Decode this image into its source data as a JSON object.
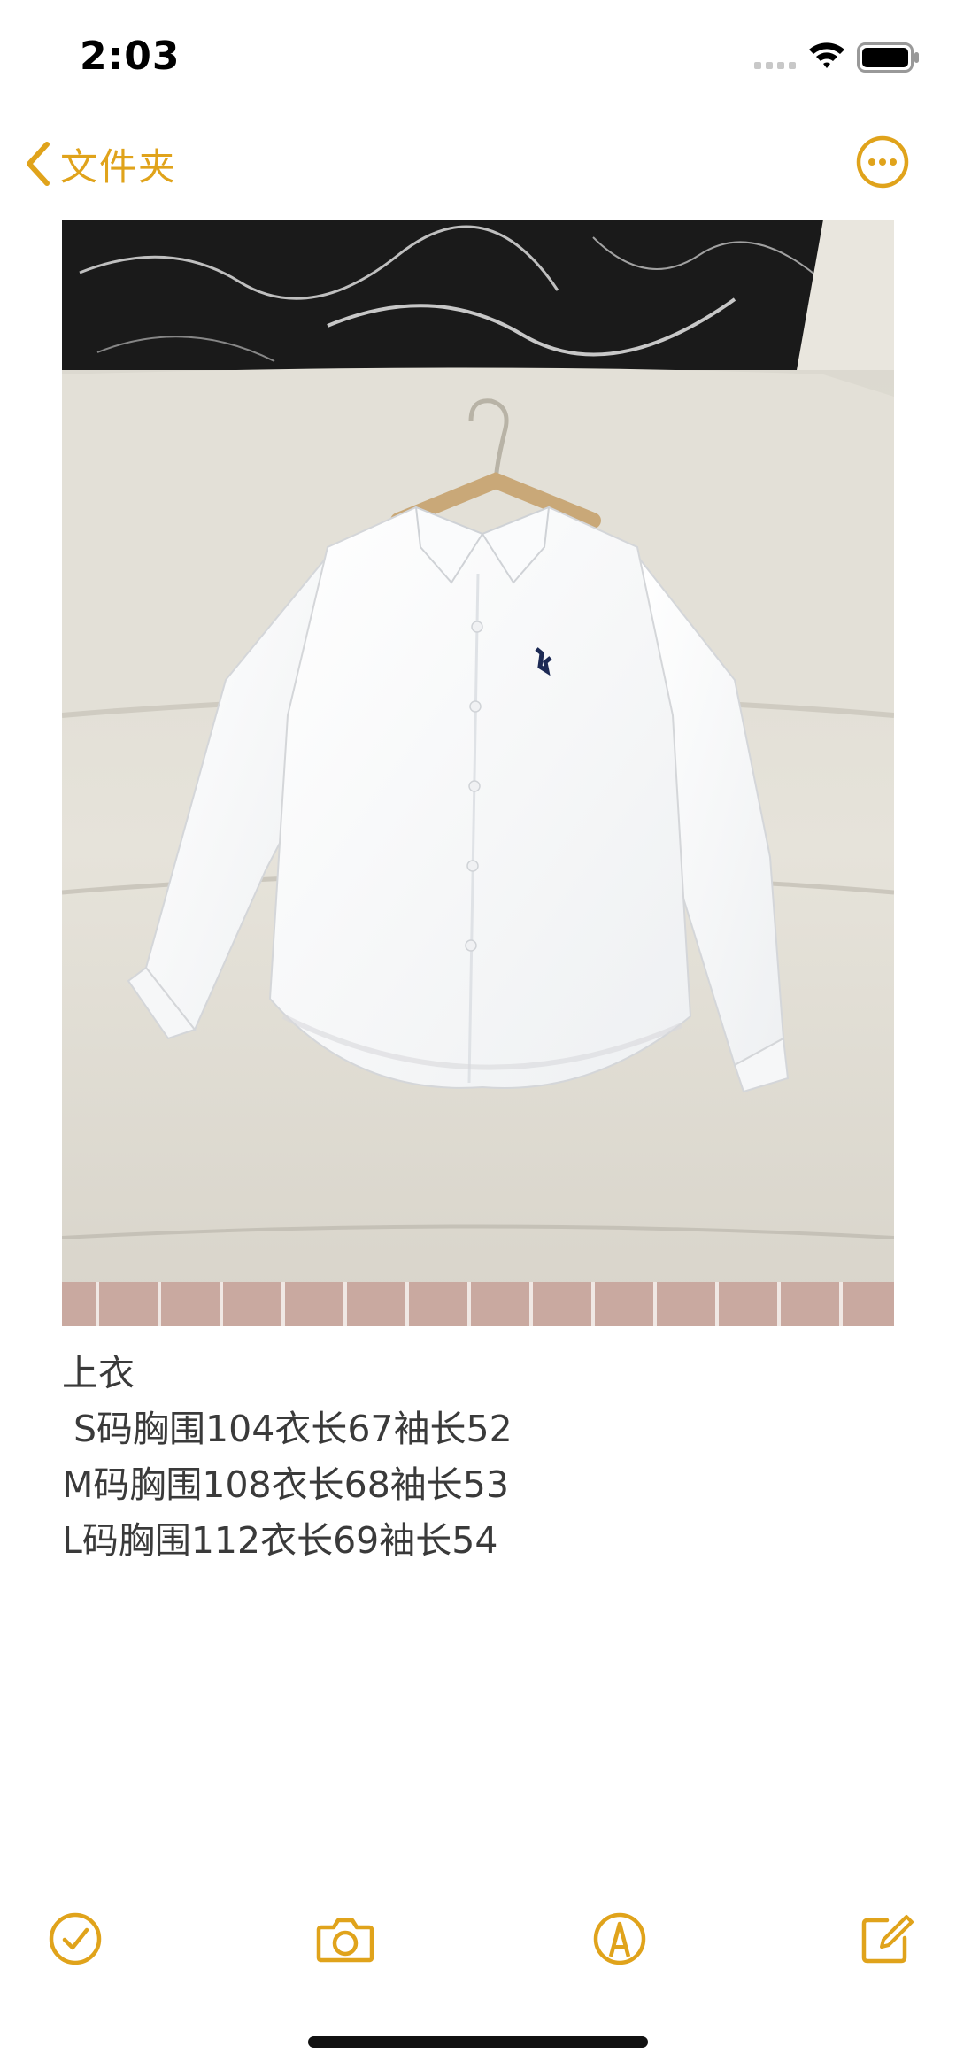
{
  "status_bar": {
    "time": "2:03"
  },
  "nav": {
    "back_label": "文件夹"
  },
  "note": {
    "lines": [
      "上衣",
      " S码胸围104衣长67袖长52",
      "M码胸围108衣长68袖长53",
      "L码胸围112衣长69袖长54"
    ]
  },
  "icons": {
    "back": "chevron-left-icon",
    "more": "ellipsis-circle-icon",
    "checklist": "checkmark-circle-icon",
    "camera": "camera-icon",
    "markup": "pen-tip-circle-icon",
    "compose": "compose-icon"
  },
  "colors": {
    "accent": "#E0A31B",
    "text": "#3a3a3a"
  }
}
